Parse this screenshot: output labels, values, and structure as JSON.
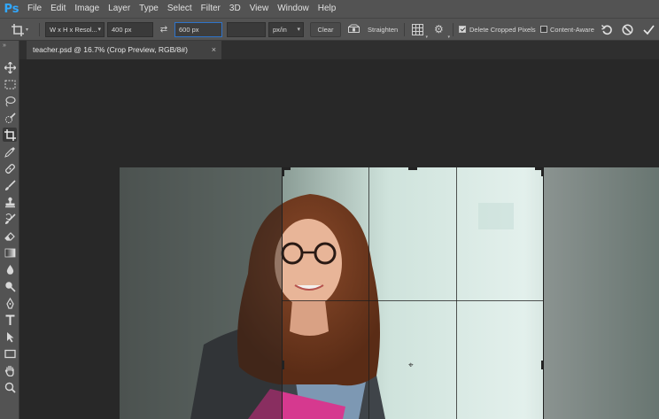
{
  "app": {
    "logo": "Ps"
  },
  "menu": [
    "File",
    "Edit",
    "Image",
    "Layer",
    "Type",
    "Select",
    "Filter",
    "3D",
    "View",
    "Window",
    "Help"
  ],
  "options": {
    "crop_tool_icon": "crop-icon",
    "preset": "W x H x Resol...",
    "width": "400 px",
    "swap_icon": "swap-icon",
    "height": "600 px",
    "resolution": "",
    "units": "px/in",
    "clear_label": "Clear",
    "straighten_icon": "level-icon",
    "straighten_label": "Straighten",
    "overlay_icon": "grid-icon",
    "settings_icon": "gear-icon",
    "delete_cropped_label": "Delete Cropped Pixels",
    "delete_cropped_checked": true,
    "content_aware_label": "Content-Aware",
    "content_aware_checked": false,
    "reset_icon": "reset-icon",
    "cancel_icon": "cancel-icon",
    "commit_icon": "checkmark-icon"
  },
  "document": {
    "tab_title": "teacher.psd @ 16.7% (Crop Preview, RGB/8#)",
    "close_glyph": "×"
  },
  "tools": [
    "move-icon",
    "marquee-icon",
    "lasso-icon",
    "quick-select-icon",
    "crop-icon",
    "eyedropper-icon",
    "healing-brush-icon",
    "brush-icon",
    "stamp-icon",
    "history-brush-icon",
    "eraser-icon",
    "gradient-icon",
    "blur-icon",
    "dodge-icon",
    "pen-icon",
    "type-icon",
    "path-select-icon",
    "rectangle-icon",
    "hand-icon",
    "zoom-icon"
  ],
  "colors": {
    "accent": "#31a8ff",
    "panel": "#535353",
    "canvas_bg": "#282828"
  }
}
